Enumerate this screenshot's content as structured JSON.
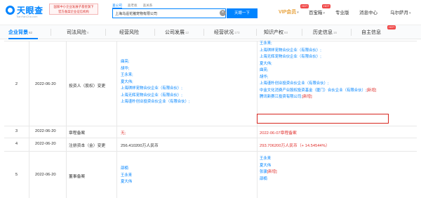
{
  "header": {
    "logo_text": "天眼查",
    "logo_domain": "TianYanCha.com",
    "banner_line1": "国家中小企业发展子基金旗下",
    "banner_line2": "官方备案企业征信机构",
    "search_tabs": [
      "查公司",
      "查老板",
      "查关系"
    ],
    "search_value": "上海乌遥花猪宠物有限公司",
    "search_button": "天眼一下",
    "clear_symbol": "×",
    "nav": {
      "vip": "VIP会员",
      "baibao": "百宝箱",
      "pro": "专业版",
      "messages": "消息中心",
      "user": "乌尔萨月"
    },
    "hot_badge": "HOT",
    "caret": "▾"
  },
  "tabs": [
    {
      "label": "企业背景",
      "count": "62"
    },
    {
      "label": "司法风险",
      "count": "6"
    },
    {
      "label": "经营风险",
      "count": ""
    },
    {
      "label": "公司发展",
      "count": "12"
    },
    {
      "label": "经营状况",
      "count": "173"
    },
    {
      "label": "知识产权",
      "count": "93"
    },
    {
      "label": "历史信息",
      "count": "16"
    },
    {
      "label": "自主信息",
      "count": ""
    }
  ],
  "rows": [
    {
      "index": "2",
      "date": "2022-06-20",
      "item": "投资人（股权）变更",
      "before": [
        "曲亮;",
        "胡华;",
        "王永来;",
        "夏大伟;",
        "上海琪祥宠物合伙企业（有限合伙）;",
        "上海无辉宠物合伙企业（有限合伙）;",
        "上海谨朴创业投资合伙企业（有限合伙）;"
      ],
      "after": [
        {
          "text": "王永来;"
        },
        {
          "text": "上海琪祥宠物合伙企业（有限合伙）;"
        },
        {
          "text": "上海无辉宠物合伙企业（有限合伙）;"
        },
        {
          "text": "夏大伟;"
        },
        {
          "text": "曲亮;"
        },
        {
          "text": "胡华;"
        },
        {
          "text": "上海谨朴创业投资合伙企业（有限合伙）;"
        },
        {
          "text": "中金文化消费产业股权投资基金（厦门）合伙企业（有限合伙）;",
          "tag": "[新增]"
        },
        {
          "text": "腾讯新赛江投资有限公司;",
          "tag": "[新增]"
        }
      ]
    },
    {
      "index": "3",
      "date": "2022-06-20",
      "item": "章程备案",
      "before_text": "无;",
      "after_text": "2022-06-07章程备案"
    },
    {
      "index": "4",
      "date": "2022-06-20",
      "item": "注册资本（金）变更",
      "before_text": "256.410200万人民币",
      "after_text": "293.706200万人民币（+ 14.54544%）"
    },
    {
      "index": "5",
      "date": "2022-06-20",
      "item": "董事备案",
      "before": [
        "邵楠",
        "王永来",
        "夏大伟"
      ],
      "after": [
        {
          "text": "王永来"
        },
        {
          "text": "夏大伟"
        },
        {
          "text": "张骏",
          "tag": "[新增]"
        },
        {
          "text": "邵楠"
        }
      ]
    }
  ],
  "colors": {
    "brand": "#0084ff",
    "vip": "#e8a33d",
    "alert_red": "#e0312e",
    "hot": "#f04646"
  }
}
